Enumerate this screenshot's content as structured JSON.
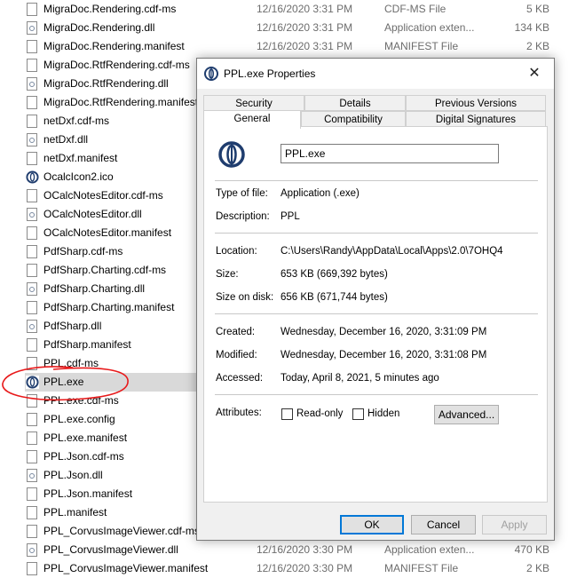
{
  "files": [
    {
      "name": "MigraDoc.Rendering.cdf-ms",
      "date": "12/16/2020 3:31 PM",
      "type": "CDF-MS File",
      "size": "5 KB",
      "icon": "file-icon"
    },
    {
      "name": "MigraDoc.Rendering.dll",
      "date": "12/16/2020 3:31 PM",
      "type": "Application exten...",
      "size": "134 KB",
      "icon": "dll-icon"
    },
    {
      "name": "MigraDoc.Rendering.manifest",
      "date": "12/16/2020 3:31 PM",
      "type": "MANIFEST File",
      "size": "2 KB",
      "icon": "file-icon"
    },
    {
      "name": "MigraDoc.RtfRendering.cdf-ms",
      "date": "",
      "type": "",
      "size": "",
      "icon": "file-icon"
    },
    {
      "name": "MigraDoc.RtfRendering.dll",
      "date": "",
      "type": "",
      "size": "",
      "icon": "dll-icon"
    },
    {
      "name": "MigraDoc.RtfRendering.manifest",
      "date": "",
      "type": "",
      "size": "",
      "icon": "file-icon"
    },
    {
      "name": "netDxf.cdf-ms",
      "date": "",
      "type": "",
      "size": "",
      "icon": "file-icon"
    },
    {
      "name": "netDxf.dll",
      "date": "",
      "type": "",
      "size": "",
      "icon": "dll-icon"
    },
    {
      "name": "netDxf.manifest",
      "date": "",
      "type": "",
      "size": "",
      "icon": "file-icon"
    },
    {
      "name": "OcalcIcon2.ico",
      "date": "",
      "type": "",
      "size": "",
      "icon": "app-icon"
    },
    {
      "name": "OCalcNotesEditor.cdf-ms",
      "date": "",
      "type": "",
      "size": "",
      "icon": "file-icon"
    },
    {
      "name": "OCalcNotesEditor.dll",
      "date": "",
      "type": "",
      "size": "",
      "icon": "dll-icon"
    },
    {
      "name": "OCalcNotesEditor.manifest",
      "date": "",
      "type": "",
      "size": "",
      "icon": "file-icon"
    },
    {
      "name": "PdfSharp.cdf-ms",
      "date": "",
      "type": "",
      "size": "",
      "icon": "file-icon"
    },
    {
      "name": "PdfSharp.Charting.cdf-ms",
      "date": "",
      "type": "",
      "size": "",
      "icon": "file-icon"
    },
    {
      "name": "PdfSharp.Charting.dll",
      "date": "",
      "type": "",
      "size": "",
      "icon": "dll-icon"
    },
    {
      "name": "PdfSharp.Charting.manifest",
      "date": "",
      "type": "",
      "size": "",
      "icon": "file-icon"
    },
    {
      "name": "PdfSharp.dll",
      "date": "",
      "type": "",
      "size": "",
      "icon": "dll-icon"
    },
    {
      "name": "PdfSharp.manifest",
      "date": "",
      "type": "",
      "size": "",
      "icon": "file-icon"
    },
    {
      "name": "PPL.cdf-ms",
      "date": "",
      "type": "",
      "size": "",
      "icon": "file-icon"
    },
    {
      "name": "PPL.exe",
      "date": "",
      "type": "",
      "size": "",
      "icon": "app-icon",
      "selected": true
    },
    {
      "name": "PPL.exe.cdf-ms",
      "date": "",
      "type": "",
      "size": "",
      "icon": "file-icon"
    },
    {
      "name": "PPL.exe.config",
      "date": "",
      "type": "",
      "size": "",
      "icon": "file-icon"
    },
    {
      "name": "PPL.exe.manifest",
      "date": "",
      "type": "",
      "size": "",
      "icon": "file-icon"
    },
    {
      "name": "PPL.Json.cdf-ms",
      "date": "",
      "type": "",
      "size": "",
      "icon": "file-icon"
    },
    {
      "name": "PPL.Json.dll",
      "date": "",
      "type": "",
      "size": "",
      "icon": "dll-icon"
    },
    {
      "name": "PPL.Json.manifest",
      "date": "",
      "type": "",
      "size": "",
      "icon": "file-icon"
    },
    {
      "name": "PPL.manifest",
      "date": "",
      "type": "",
      "size": "",
      "icon": "file-icon"
    },
    {
      "name": "PPL_CorvusImageViewer.cdf-ms",
      "date": "",
      "type": "",
      "size": "",
      "icon": "file-icon"
    },
    {
      "name": "PPL_CorvusImageViewer.dll",
      "date": "12/16/2020 3:30 PM",
      "type": "Application exten...",
      "size": "470 KB",
      "icon": "dll-icon"
    },
    {
      "name": "PPL_CorvusImageViewer.manifest",
      "date": "12/16/2020 3:30 PM",
      "type": "MANIFEST File",
      "size": "2 KB",
      "icon": "file-icon"
    }
  ],
  "dialog": {
    "title": "PPL.exe Properties",
    "close": "✕",
    "tabs_top": [
      "Security",
      "Details",
      "Previous Versions"
    ],
    "tabs_bottom": [
      "General",
      "Compatibility",
      "Digital Signatures"
    ],
    "file_name": "PPL.exe",
    "type_label": "Type of file:",
    "type_value": "Application (.exe)",
    "desc_label": "Description:",
    "desc_value": "PPL",
    "location_label": "Location:",
    "location_value": "C:\\Users\\Randy\\AppData\\Local\\Apps\\2.0\\7OHQ4",
    "size_label": "Size:",
    "size_value": "653 KB (669,392 bytes)",
    "disk_label": "Size on disk:",
    "disk_value": "656 KB (671,744 bytes)",
    "created_label": "Created:",
    "created_value": "Wednesday, December 16, 2020, 3:31:09 PM",
    "modified_label": "Modified:",
    "modified_value": "Wednesday, December 16, 2020, 3:31:08 PM",
    "accessed_label": "Accessed:",
    "accessed_value": "Today, April 8, 2021, 5 minutes ago",
    "attributes_label": "Attributes:",
    "readonly_label": "Read-only",
    "hidden_label": "Hidden",
    "advanced_label": "Advanced...",
    "ok_label": "OK",
    "cancel_label": "Cancel",
    "apply_label": "Apply"
  },
  "colors": {
    "annotation": "#e8191a",
    "accent": "#0078d7",
    "selection": "#d9d9d9"
  }
}
